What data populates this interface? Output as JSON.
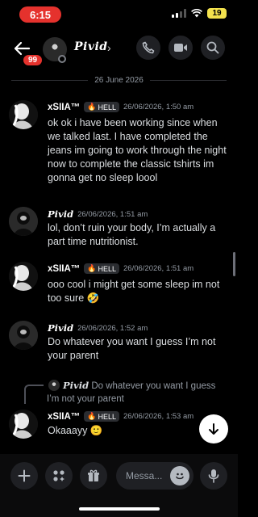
{
  "status_bar": {
    "time": "6:15",
    "battery": "19"
  },
  "header": {
    "unread_badge": "99",
    "username": "Pivid",
    "chevron": "›"
  },
  "date_divider": "26 June 2026",
  "messages": [
    {
      "username": "xSIIA™",
      "tag": "HELL",
      "timestamp": "26/06/2026, 1:50 am",
      "text": "ok ok i have been working since when we talked last. I have completed the jeans im going to work through the night now to complete the classic tshirts im gonna get no sleep loool"
    },
    {
      "username": "Pivid",
      "timestamp": "26/06/2026, 1:51 am",
      "text": "lol, don’t ruin your body, I’m actually a part time nutritionist."
    },
    {
      "username": "xSIIA™",
      "tag": "HELL",
      "timestamp": "26/06/2026, 1:51 am",
      "text": "ooo cool i might get some sleep im not too sure 🤣"
    },
    {
      "username": "Pivid",
      "timestamp": "26/06/2026, 1:52 am",
      "text": "Do whatever you want I guess I’m not your parent"
    },
    {
      "username": "xSIIA™",
      "tag": "HELL",
      "timestamp": "26/06/2026, 1:53 am",
      "text": "Okaaayy 🙂"
    }
  ],
  "reply": {
    "username": "Pivid",
    "text": "Do whatever you want I guess I’m not your parent"
  },
  "composer": {
    "placeholder": "Messa..."
  },
  "icons": [
    "back-arrow",
    "phone",
    "video",
    "search",
    "plus",
    "apps",
    "gift",
    "emoji",
    "microphone",
    "arrow-down",
    "fire"
  ],
  "colors": {
    "accent_red": "#e5322d",
    "battery": "#f3e24d",
    "background": "#000000",
    "muted_text": "#949ba4"
  }
}
